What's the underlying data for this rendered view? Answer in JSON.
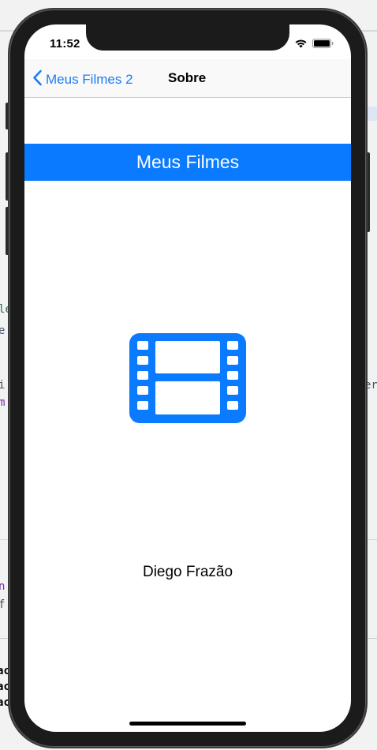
{
  "status_bar": {
    "time": "11:52",
    "icons": [
      "wifi-icon",
      "battery-icon"
    ]
  },
  "navigation": {
    "back_label": "Meus Filmes 2",
    "title": "Sobre"
  },
  "banner": {
    "title": "Meus Filmes"
  },
  "content": {
    "icon": "film-icon",
    "author": "Diego Frazão"
  },
  "colors": {
    "accent": "#0a7bff",
    "back_link": "#1a7cf4",
    "device_frame": "#1b1b1b"
  },
  "background_fragments": [
    "le",
    "e",
    "i",
    "m",
    "er",
    "n",
    "f",
    "ac",
    "ac",
    "ac"
  ]
}
